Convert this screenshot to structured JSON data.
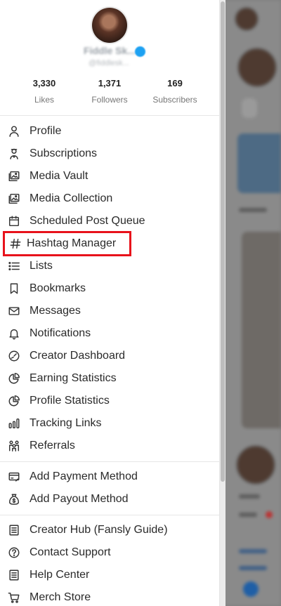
{
  "profile": {
    "display_name": "Fiddle Sk...",
    "username": "@fiddlesk...",
    "stats": [
      {
        "value": "3,330",
        "label": "Likes"
      },
      {
        "value": "1,371",
        "label": "Followers"
      },
      {
        "value": "169",
        "label": "Subscribers"
      }
    ]
  },
  "menu": {
    "primary": [
      {
        "label": "Profile",
        "icon": "user-icon"
      },
      {
        "label": "Subscriptions",
        "icon": "subscriptions-icon"
      },
      {
        "label": "Media Vault",
        "icon": "media-vault-icon"
      },
      {
        "label": "Media Collection",
        "icon": "media-collection-icon"
      },
      {
        "label": "Scheduled Post Queue",
        "icon": "calendar-icon"
      },
      {
        "label": "Hashtag Manager",
        "icon": "hashtag-icon"
      },
      {
        "label": "Lists",
        "icon": "list-icon"
      },
      {
        "label": "Bookmarks",
        "icon": "bookmark-icon"
      },
      {
        "label": "Messages",
        "icon": "envelope-icon"
      },
      {
        "label": "Notifications",
        "icon": "bell-icon"
      },
      {
        "label": "Creator Dashboard",
        "icon": "gauge-icon"
      },
      {
        "label": "Earning Statistics",
        "icon": "pie-chart-icon"
      },
      {
        "label": "Profile Statistics",
        "icon": "pie-chart-icon"
      },
      {
        "label": "Tracking Links",
        "icon": "bar-chart-icon"
      },
      {
        "label": "Referrals",
        "icon": "people-icon"
      }
    ],
    "payments": [
      {
        "label": "Add Payment Method",
        "icon": "payment-card-icon"
      },
      {
        "label": "Add Payout Method",
        "icon": "money-bag-icon"
      }
    ],
    "support": [
      {
        "label": "Creator Hub (Fansly Guide)",
        "icon": "book-icon"
      },
      {
        "label": "Contact Support",
        "icon": "question-icon"
      },
      {
        "label": "Help Center",
        "icon": "document-icon"
      },
      {
        "label": "Merch Store",
        "icon": "cart-icon"
      }
    ]
  },
  "highlight_color": "#e8121b"
}
